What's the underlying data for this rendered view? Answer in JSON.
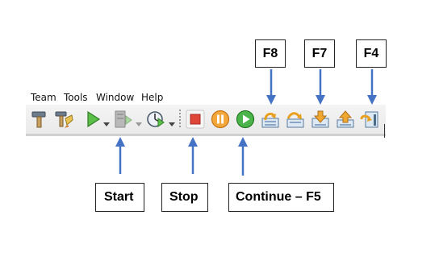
{
  "menu": [
    "Team",
    "Tools",
    "Window",
    "Help"
  ],
  "toolbar": {
    "icons": [
      "build-hammer-icon",
      "clean-build-icon",
      "run-icon",
      "debug-icon",
      "profile-icon",
      "finish-debug-icon",
      "pause-icon",
      "continue-icon",
      "step-over-icon",
      "step-over-expression-icon",
      "step-into-icon",
      "step-out-icon",
      "run-to-cursor-icon"
    ]
  },
  "labels": {
    "f8": "F8",
    "f7": "F7",
    "f4": "F4",
    "start": "Start",
    "stop": "Stop",
    "continue": "Continue – F5"
  },
  "colors": {
    "arrow": "#4472c4",
    "stop_red": "#e0453a",
    "pause_orange": "#f09a2a",
    "run_green": "#3fae3a"
  }
}
